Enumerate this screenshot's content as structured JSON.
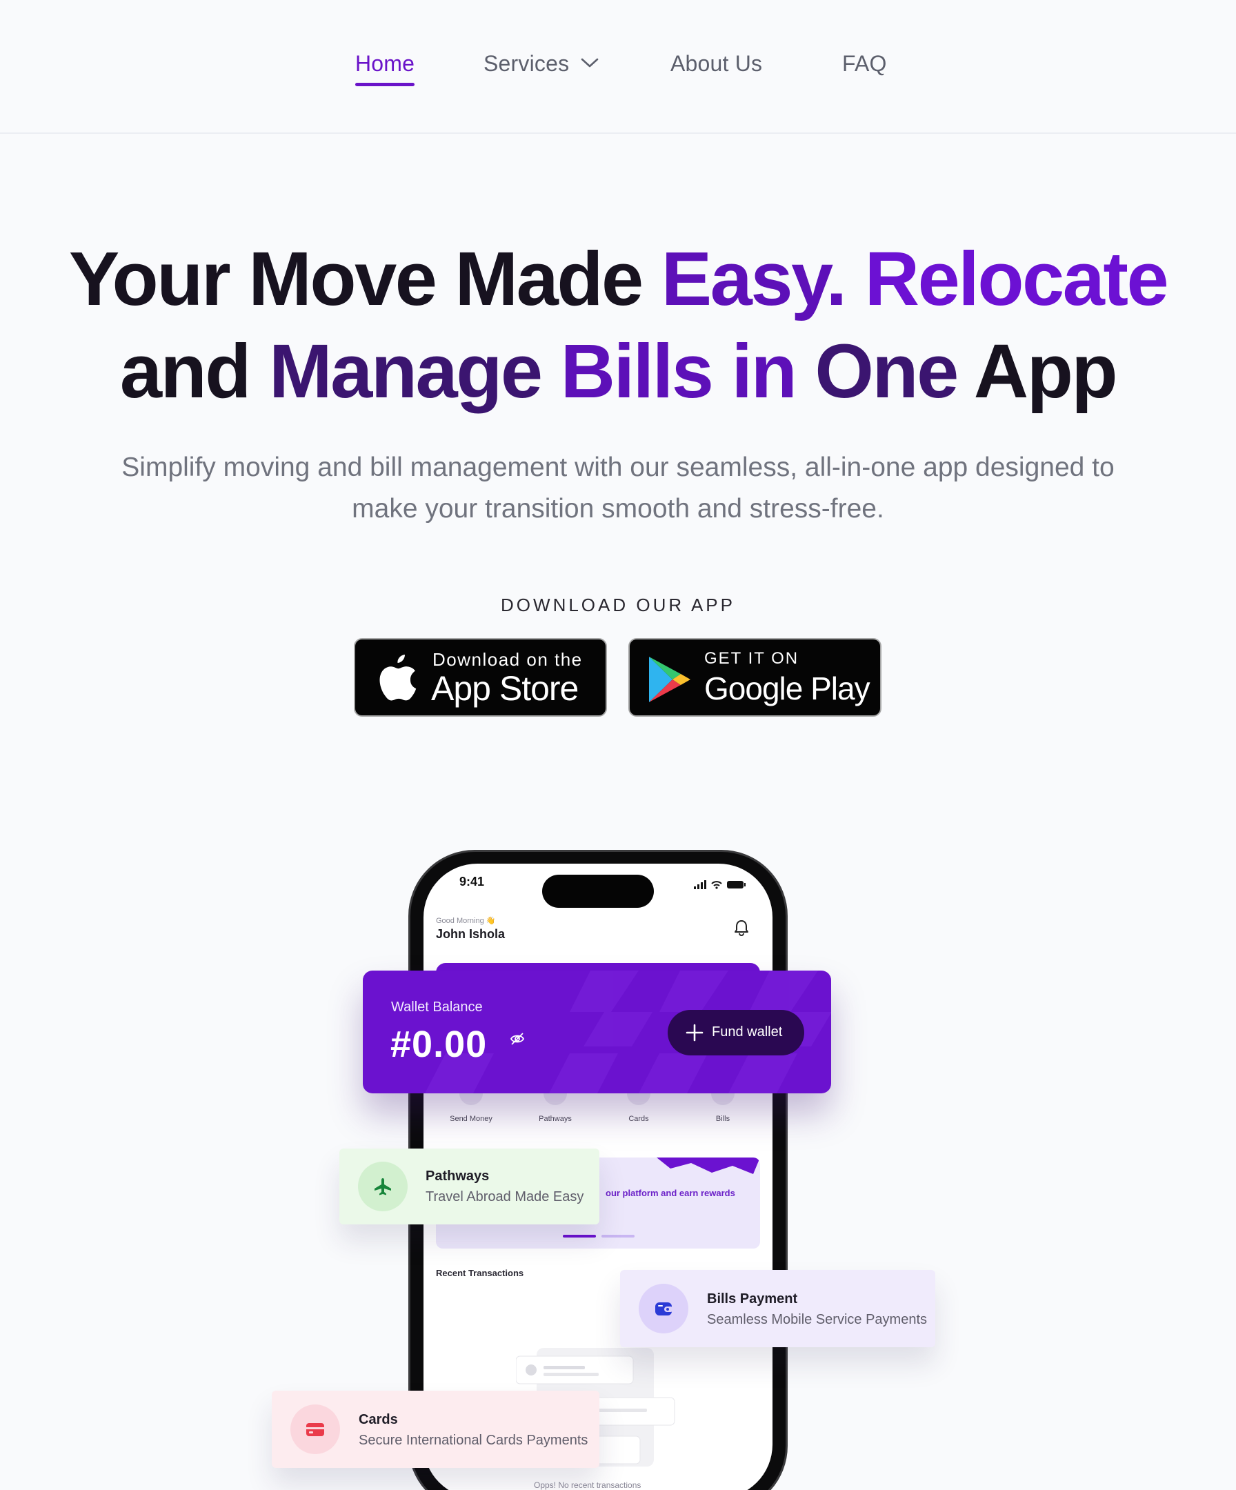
{
  "nav": {
    "home": "Home",
    "services": "Services",
    "about": "About Us",
    "faq": "FAQ"
  },
  "hero": {
    "line1_a": "Your Move",
    "line1_b": "Made",
    "line1_c": "Easy.",
    "line1_d": "Relocate",
    "line2_a": "and",
    "line2_b": "Manage",
    "line2_c": "Bills in",
    "line2_d": "One",
    "line2_e": "App",
    "subtitle_1": "Simplify moving and bill management with our seamless, all-in-one app designed to",
    "subtitle_2": "make your transition smooth and stress-free.",
    "download_label": "DOWNLOAD OUR APP"
  },
  "stores": {
    "appstore_small": "Download on the",
    "appstore_big": "App Store",
    "google_small": "GET IT ON",
    "google_big": "Google Play"
  },
  "phone": {
    "time": "9:41",
    "greeting": "Good Morning 👋",
    "user_name": "John Ishola",
    "quick_actions": [
      "Send Money",
      "Pathways",
      "Cards",
      "Bills"
    ],
    "promo_text": "our platform and earn rewards",
    "recent_title": "Recent Transactions",
    "empty_text": "Opps! No recent transactions"
  },
  "wallet": {
    "label": "Wallet Balance",
    "amount": "#0.00",
    "fund_label": "Fund wallet"
  },
  "features": {
    "pathways_title": "Pathways",
    "pathways_sub": "Travel Abroad Made Easy",
    "bills_title": "Bills Payment",
    "bills_sub": "Seamless Mobile Service Payments",
    "cards_title": "Cards",
    "cards_sub": "Secure International Cards Payments"
  },
  "colors": {
    "accent": "#6a13c9",
    "wallet_bg": "#6b12cf",
    "fund_button": "#2a0852",
    "pathways_bg": "#ebf9e9",
    "bills_bg": "#f0ebfc",
    "cards_bg": "#fdecef"
  },
  "icons": {
    "services_chevron": "chevron-down-icon",
    "apple": "apple-icon",
    "google_play": "google-play-icon",
    "bell": "bell-icon",
    "eye_off": "eye-off-icon",
    "plus": "plus-icon",
    "airplane": "airplane-icon",
    "wallet": "wallet-icon",
    "card": "credit-card-icon"
  }
}
